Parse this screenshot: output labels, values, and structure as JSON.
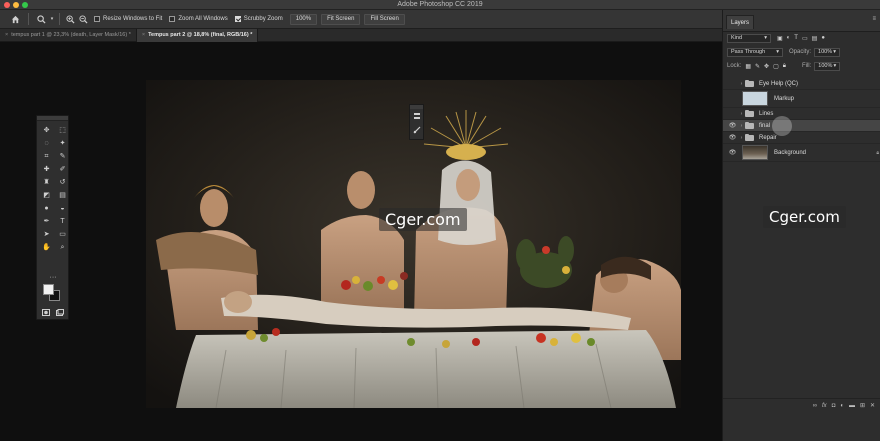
{
  "app": {
    "title": "Adobe Photoshop CC 2019"
  },
  "options_bar": {
    "home_icon": "home-icon",
    "zoom_tool_icon": "magnifier-icon",
    "zoom_in_icon": "zoom-in-icon",
    "zoom_out_icon": "zoom-out-icon",
    "resize_windows_label": "Resize Windows to Fit",
    "resize_windows_checked": false,
    "zoom_all_label": "Zoom All Windows",
    "zoom_all_checked": false,
    "scrubby_zoom_label": "Scrubby Zoom",
    "scrubby_zoom_checked": true,
    "zoom_100_label": "100%",
    "fit_screen_label": "Fit Screen",
    "fill_screen_label": "Fill Screen"
  },
  "document_tabs": [
    {
      "label": "tempus part 1 @ 23,3% (death, Layer Mask/16) *",
      "active": false
    },
    {
      "label": "Tempus part 2 @ 18,8% (final, RGB/16) *",
      "active": true
    }
  ],
  "tools": [
    "move-tool-icon",
    "marquee-tool-icon",
    "lasso-tool-icon",
    "magic-wand-icon",
    "crop-tool-icon",
    "eyedropper-icon",
    "healing-brush-icon",
    "brush-tool-icon",
    "clone-stamp-icon",
    "history-brush-icon",
    "eraser-icon",
    "gradient-tool-icon",
    "blur-tool-icon",
    "dodge-tool-icon",
    "pen-tool-icon",
    "type-tool-icon",
    "path-selection-icon",
    "shape-tool-icon",
    "hand-tool-icon",
    "zoom-tool-icon"
  ],
  "layers_panel": {
    "tab_label": "Layers",
    "filter_kind": "Kind",
    "blend_mode": "Pass Through",
    "opacity_label": "Opacity:",
    "opacity_value": "100%",
    "lock_label": "Lock:",
    "fill_label": "Fill:",
    "fill_value": "100%",
    "layers": [
      {
        "name": "Eye Help (QC)",
        "type": "group",
        "visible": false,
        "selected": false
      },
      {
        "name": "Markup",
        "type": "pixel",
        "visible": false,
        "selected": false
      },
      {
        "name": "Lines",
        "type": "group",
        "visible": false,
        "selected": false
      },
      {
        "name": "final",
        "type": "group",
        "visible": true,
        "selected": true
      },
      {
        "name": "Repair",
        "type": "group",
        "visible": true,
        "selected": false
      },
      {
        "name": "Background",
        "type": "pixel",
        "visible": true,
        "selected": false,
        "locked": true
      }
    ],
    "footer_icons": [
      "link-icon",
      "fx-icon",
      "mask-icon",
      "adjustment-icon",
      "group-icon",
      "new-layer-icon",
      "trash-icon"
    ]
  },
  "watermarks": {
    "canvas": "Cger.com",
    "panel": "Cger.com"
  },
  "colors": {
    "foreground": "#f2f2f2",
    "background": "#111111",
    "selected_layer": "#454545"
  }
}
